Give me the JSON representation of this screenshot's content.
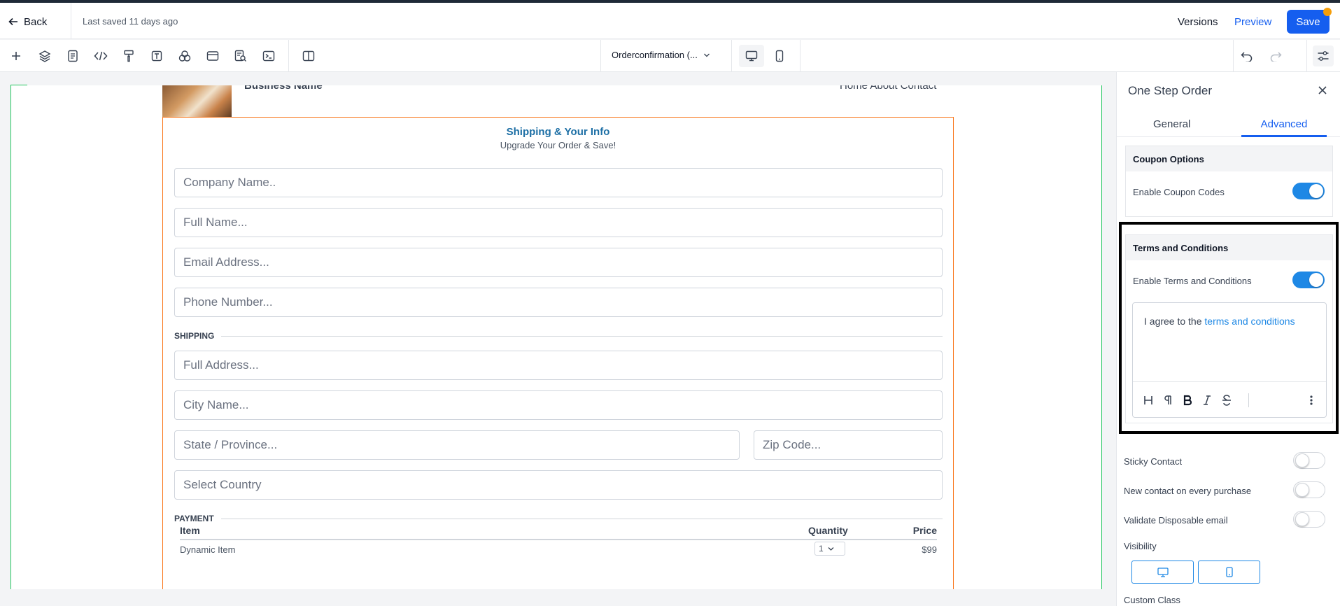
{
  "topbar": {
    "back_label": "Back",
    "saved_text": "Last saved 11 days ago",
    "versions_label": "Versions",
    "preview_label": "Preview",
    "save_label": "Save"
  },
  "toolbar": {
    "page_select": "Orderconfirmation (..."
  },
  "canvas": {
    "business_name": "Business Name",
    "nav_links": "Home  About  Contact",
    "form_title": "Shipping & Your Info",
    "form_subtitle": "Upgrade Your Order & Save!",
    "fields": {
      "company": "Company Name..",
      "full_name": "Full Name...",
      "email": "Email Address...",
      "phone": "Phone Number...",
      "address": "Full Address...",
      "city": "City Name...",
      "state": "State / Province...",
      "zip": "Zip Code...",
      "country": "Select Country"
    },
    "shipping_label": "SHIPPING",
    "payment_label": "PAYMENT",
    "table": {
      "headers": [
        "Item",
        "Quantity",
        "Price"
      ],
      "row": {
        "item": "Dynamic Item",
        "quantity": "1",
        "price": "$99"
      }
    }
  },
  "panel": {
    "title": "One Step Order",
    "tabs": [
      "General",
      "Advanced"
    ],
    "active_tab": "Advanced",
    "coupon": {
      "heading": "Coupon Options",
      "toggle_label": "Enable Coupon Codes",
      "enabled": true
    },
    "terms": {
      "heading": "Terms and Conditions",
      "toggle_label": "Enable Terms and Conditions",
      "enabled": true,
      "text_prefix": "I agree to the",
      "text_link": "terms and conditions"
    },
    "options": [
      {
        "label": "Sticky Contact",
        "enabled": false
      },
      {
        "label": "New contact on every purchase",
        "enabled": false
      },
      {
        "label": "Validate Disposable email",
        "enabled": false
      }
    ],
    "visibility_label": "Visibility",
    "custom_class_label": "Custom Class"
  },
  "colors": {
    "accent": "#155eef",
    "toggle_on": "#1e88e5",
    "form_border": "#f97316",
    "title_blue": "#1d6fa5"
  }
}
